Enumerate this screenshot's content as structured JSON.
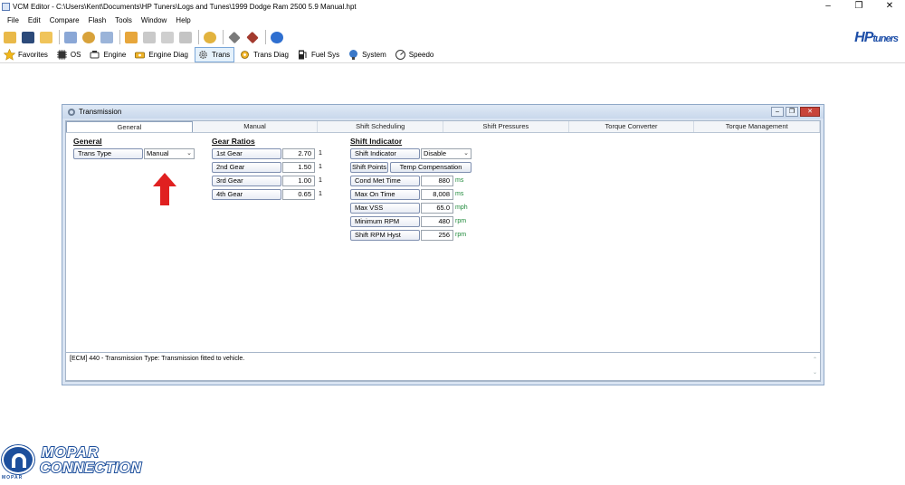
{
  "window": {
    "title": "VCM Editor - C:\\Users\\Kent\\Documents\\HP Tuners\\Logs and Tunes\\1999 Dodge Ram 2500 5.9 Manual.hpt",
    "minimize": "–",
    "maximize": "❐",
    "close": "✕"
  },
  "menu": [
    "File",
    "Edit",
    "Compare",
    "Flash",
    "Tools",
    "Window",
    "Help"
  ],
  "logo": {
    "brand": "HP",
    "suffix": "tuners"
  },
  "nav": [
    {
      "label": "Favorites",
      "icon": "star-icon"
    },
    {
      "label": "OS",
      "icon": "chip-icon"
    },
    {
      "label": "Engine",
      "icon": "engine-icon"
    },
    {
      "label": "Engine Diag",
      "icon": "engine-diag-icon"
    },
    {
      "label": "Trans",
      "icon": "gear-icon"
    },
    {
      "label": "Trans Diag",
      "icon": "trans-diag-icon"
    },
    {
      "label": "Fuel Sys",
      "icon": "fuel-pump-icon"
    },
    {
      "label": "System",
      "icon": "system-icon"
    },
    {
      "label": "Speedo",
      "icon": "speedometer-icon"
    }
  ],
  "transmission": {
    "title": "Transmission",
    "tabs": [
      "General",
      "Manual",
      "Shift Scheduling",
      "Shift Pressures",
      "Torque Converter",
      "Torque Management"
    ],
    "general": {
      "heading": "General",
      "trans_type_label": "Trans Type",
      "trans_type_value": "Manual"
    },
    "gear_ratios": {
      "heading": "Gear Ratios",
      "rows": [
        {
          "label": "1st Gear",
          "value": "2.70",
          "unit": "1"
        },
        {
          "label": "2nd Gear",
          "value": "1.50",
          "unit": "1"
        },
        {
          "label": "3rd Gear",
          "value": "1.00",
          "unit": "1"
        },
        {
          "label": "4th Gear",
          "value": "0.65",
          "unit": "1"
        }
      ]
    },
    "shift_indicator": {
      "heading": "Shift Indicator",
      "indicator_label": "Shift Indicator",
      "indicator_value": "Disable",
      "shift_points_button": "Shift Points",
      "temp_comp_button": "Temp Compensation",
      "rows": [
        {
          "label": "Cond Met Time",
          "value": "880",
          "unit": "ms"
        },
        {
          "label": "Max On Time",
          "value": "8,008",
          "unit": "ms"
        },
        {
          "label": "Max VSS",
          "value": "65.0",
          "unit": "mph"
        },
        {
          "label": "Minimum RPM",
          "value": "480",
          "unit": "rpm"
        },
        {
          "label": "Shift RPM Hyst",
          "value": "256",
          "unit": "rpm"
        }
      ]
    },
    "status_text": "[ECM] 440 - Transmission Type: Transmission fitted to vehicle."
  },
  "watermark": {
    "line1": "MOPAR",
    "line2": "CONNECTION",
    "brand": "MOPAR"
  },
  "colors": {
    "accent": "#1e4fa8",
    "arrow": "#e02020",
    "unit_green": "#1f8a3b"
  }
}
